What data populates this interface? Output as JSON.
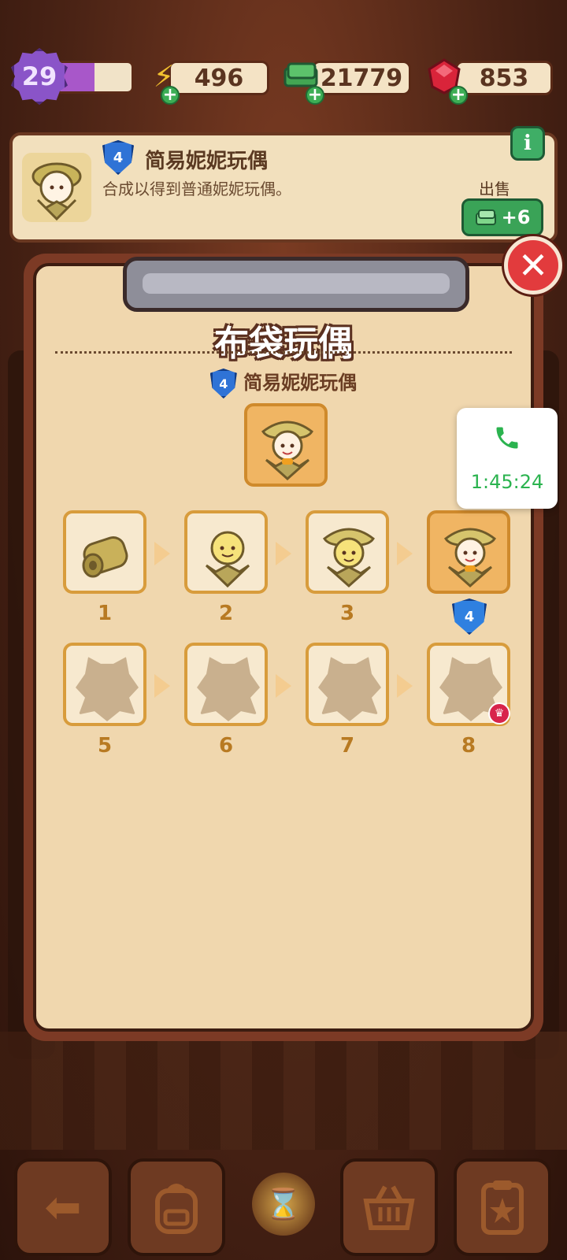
{
  "topbar": {
    "level": "29",
    "xp_progress": 0.5,
    "energy": "496",
    "cash": "21779",
    "gems": "853"
  },
  "info_banner": {
    "level_badge": "4",
    "title": "简易妮妮玩偶",
    "description": "合成以得到普通妮妮玩偶。",
    "sell_label": "出售",
    "sell_value": "+6",
    "info_icon": "i"
  },
  "panel": {
    "title": "布袋玩偶",
    "subtitle_badge": "4",
    "subtitle": "简易妮妮玩偶",
    "items_row1": [
      {
        "number": "1",
        "state": "unlocked"
      },
      {
        "number": "2",
        "state": "unlocked"
      },
      {
        "number": "3",
        "state": "unlocked"
      },
      {
        "number": "4",
        "state": "current"
      }
    ],
    "items_row2": [
      {
        "number": "5",
        "state": "locked"
      },
      {
        "number": "6",
        "state": "locked"
      },
      {
        "number": "7",
        "state": "locked"
      },
      {
        "number": "8",
        "state": "locked"
      }
    ],
    "current_badge": "4"
  },
  "call_overlay": {
    "icon": "phone-icon",
    "time": "1:45:24"
  },
  "bottombar": {
    "buttons": [
      "back-arrow-icon",
      "backpack-icon",
      "hourglass-icon",
      "basket-icon",
      "clipboard-star-icon"
    ]
  },
  "colors": {
    "accent": "#e23b3d",
    "panel_bg": "#f0d7ae",
    "slot_border": "#d89c3c",
    "shield": "#2f73d6",
    "call_green": "#2bb34f"
  }
}
